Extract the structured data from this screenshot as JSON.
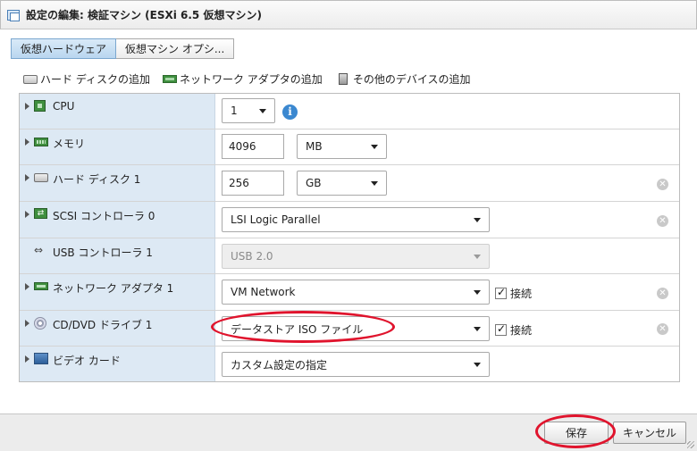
{
  "window": {
    "title": "設定の編集: 検証マシン (ESXi 6.5 仮想マシン)"
  },
  "tabs": [
    {
      "label": "仮想ハードウェア",
      "active": true
    },
    {
      "label": "仮想マシン オプシ...",
      "active": false
    }
  ],
  "toolbar": {
    "add_disk": "ハード ディスクの追加",
    "add_nic": "ネットワーク アダプタの追加",
    "add_other": "その他のデバイスの追加"
  },
  "hardware": {
    "cpu": {
      "label": "CPU",
      "value": "1"
    },
    "memory": {
      "label": "メモリ",
      "value": "4096",
      "unit": "MB"
    },
    "disk": {
      "label": "ハード ディスク 1",
      "value": "256",
      "unit": "GB"
    },
    "scsi": {
      "label": "SCSI コントローラ 0",
      "value": "LSI Logic Parallel"
    },
    "usb": {
      "label": "USB コントローラ 1",
      "value": "USB 2.0"
    },
    "nic": {
      "label": "ネットワーク アダプタ 1",
      "value": "VM Network",
      "connect_label": "接続"
    },
    "cdrom": {
      "label": "CD/DVD ドライブ 1",
      "value": "データストア ISO ファイル",
      "connect_label": "接続"
    },
    "video": {
      "label": "ビデオ カード",
      "value": "カスタム設定の指定"
    }
  },
  "footer": {
    "save": "保存",
    "cancel": "キャンセル"
  },
  "colors": {
    "annotation": "#e0142d",
    "label_bg": "#dde9f4",
    "info": "#3b88d0"
  }
}
